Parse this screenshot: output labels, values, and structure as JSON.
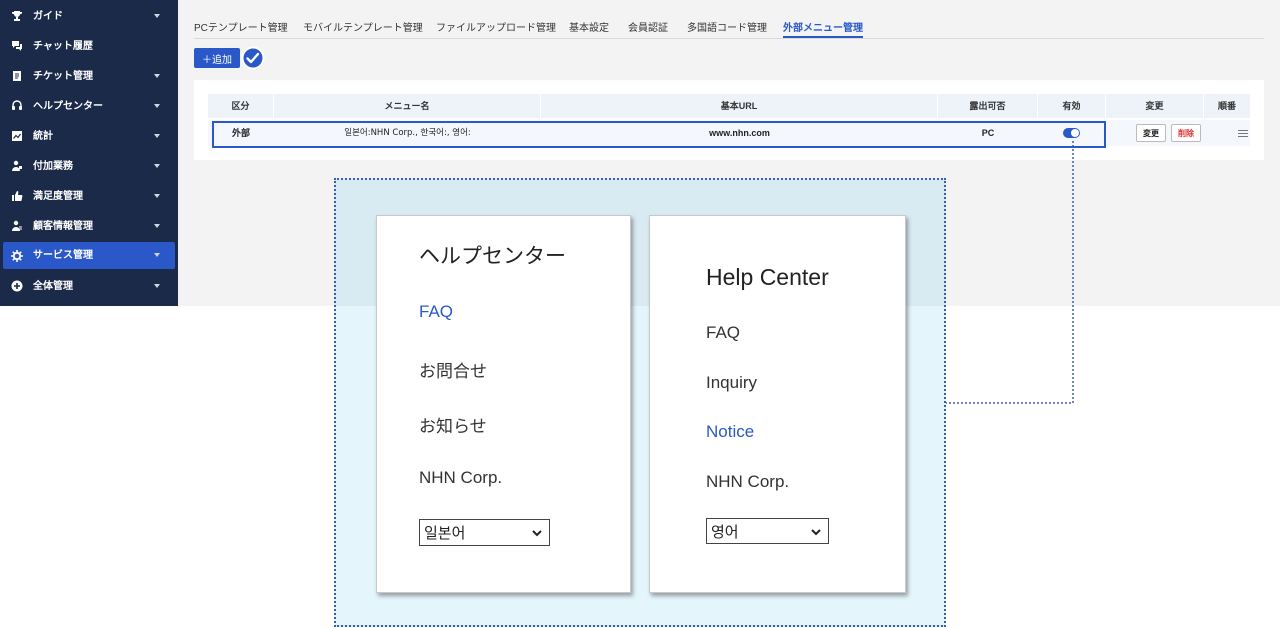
{
  "sidebar": {
    "items": [
      {
        "label": "ガイド",
        "icon": "trophy-icon"
      },
      {
        "label": "チャット履歴",
        "icon": "chat-icon"
      },
      {
        "label": "チケット管理",
        "icon": "ticket-icon"
      },
      {
        "label": "ヘルプセンター",
        "icon": "headset-icon"
      },
      {
        "label": "統計",
        "icon": "chart-icon"
      },
      {
        "label": "付加業務",
        "icon": "user-task-icon"
      },
      {
        "label": "満足度管理",
        "icon": "thumbs-up-icon"
      },
      {
        "label": "顧客情報管理",
        "icon": "customer-icon"
      },
      {
        "label": "サービス管理",
        "icon": "gear-icon"
      },
      {
        "label": "全体管理",
        "icon": "plus-circle-icon"
      }
    ],
    "active_index": 8
  },
  "tabs": [
    {
      "label": "PCテンプレート管理"
    },
    {
      "label": "モバイルテンプレート管理"
    },
    {
      "label": "ファイルアップロード管理"
    },
    {
      "label": "基本設定"
    },
    {
      "label": "会員認証"
    },
    {
      "label": "多国語コード管理"
    },
    {
      "label": "外部メニュー管理"
    }
  ],
  "toolbar": {
    "add_label": "＋追加"
  },
  "table": {
    "headers": [
      "区分",
      "メニュー名",
      "基本URL",
      "露出可否",
      "有効",
      "変更",
      "順番"
    ],
    "row": {
      "type": "外部",
      "menu_name": "일본어:NHN Corp., 한국어:, 영어:",
      "url": "www.nhn.com",
      "exposure": "PC",
      "enabled": true,
      "edit_label": "変更",
      "delete_label": "削除"
    }
  },
  "preview": {
    "ja": {
      "title": "ヘルプセンター",
      "items": [
        "FAQ",
        "お問合せ",
        "お知らせ",
        "NHN Corp."
      ],
      "link_index": 0,
      "language": "일본어"
    },
    "en": {
      "title": "Help Center",
      "items": [
        "FAQ",
        "Inquiry",
        "Notice",
        "NHN Corp."
      ],
      "link_index": 2,
      "language": "영어"
    }
  },
  "colors": {
    "sidebar_bg": "#1c2a4a",
    "accent": "#2a58c8",
    "delete": "#dd3333"
  }
}
